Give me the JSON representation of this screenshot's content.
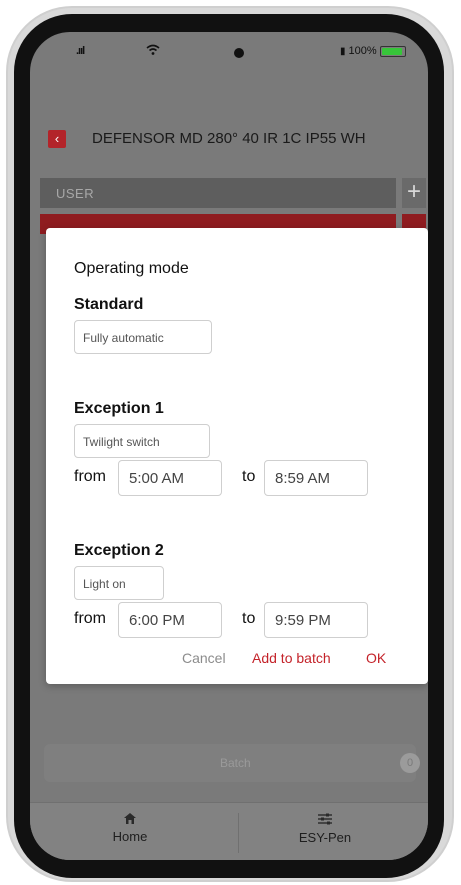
{
  "status_bar": {
    "battery_text": "100%"
  },
  "header": {
    "back_icon": "‹",
    "title": "DEFENSOR MD 280° 40 IR 1C IP55 WH"
  },
  "background": {
    "user_label": "USER",
    "plus": "+"
  },
  "dialog": {
    "title": "Operating mode",
    "standard": {
      "label": "Standard",
      "mode": "Fully automatic"
    },
    "exception1": {
      "label": "Exception 1",
      "mode": "Twilight switch",
      "from_label": "from",
      "from": "5:00 AM",
      "to_label": "to",
      "to": "8:59 AM"
    },
    "exception2": {
      "label": "Exception 2",
      "mode": "Light on",
      "from_label": "from",
      "from": "6:00 PM",
      "to_label": "to",
      "to": "9:59 PM"
    },
    "actions": {
      "cancel": "Cancel",
      "add_to_batch": "Add to batch",
      "ok": "OK"
    }
  },
  "batch_bar": {
    "label": "Batch",
    "count": "0"
  },
  "bottom_nav": [
    {
      "label": "Home",
      "icon": "home-icon"
    },
    {
      "label": "ESY-Pen",
      "icon": "sliders-icon"
    }
  ],
  "colors": {
    "accent": "#c4232a",
    "overlay": "#7a7a7a",
    "battery_green": "#37c53a"
  }
}
